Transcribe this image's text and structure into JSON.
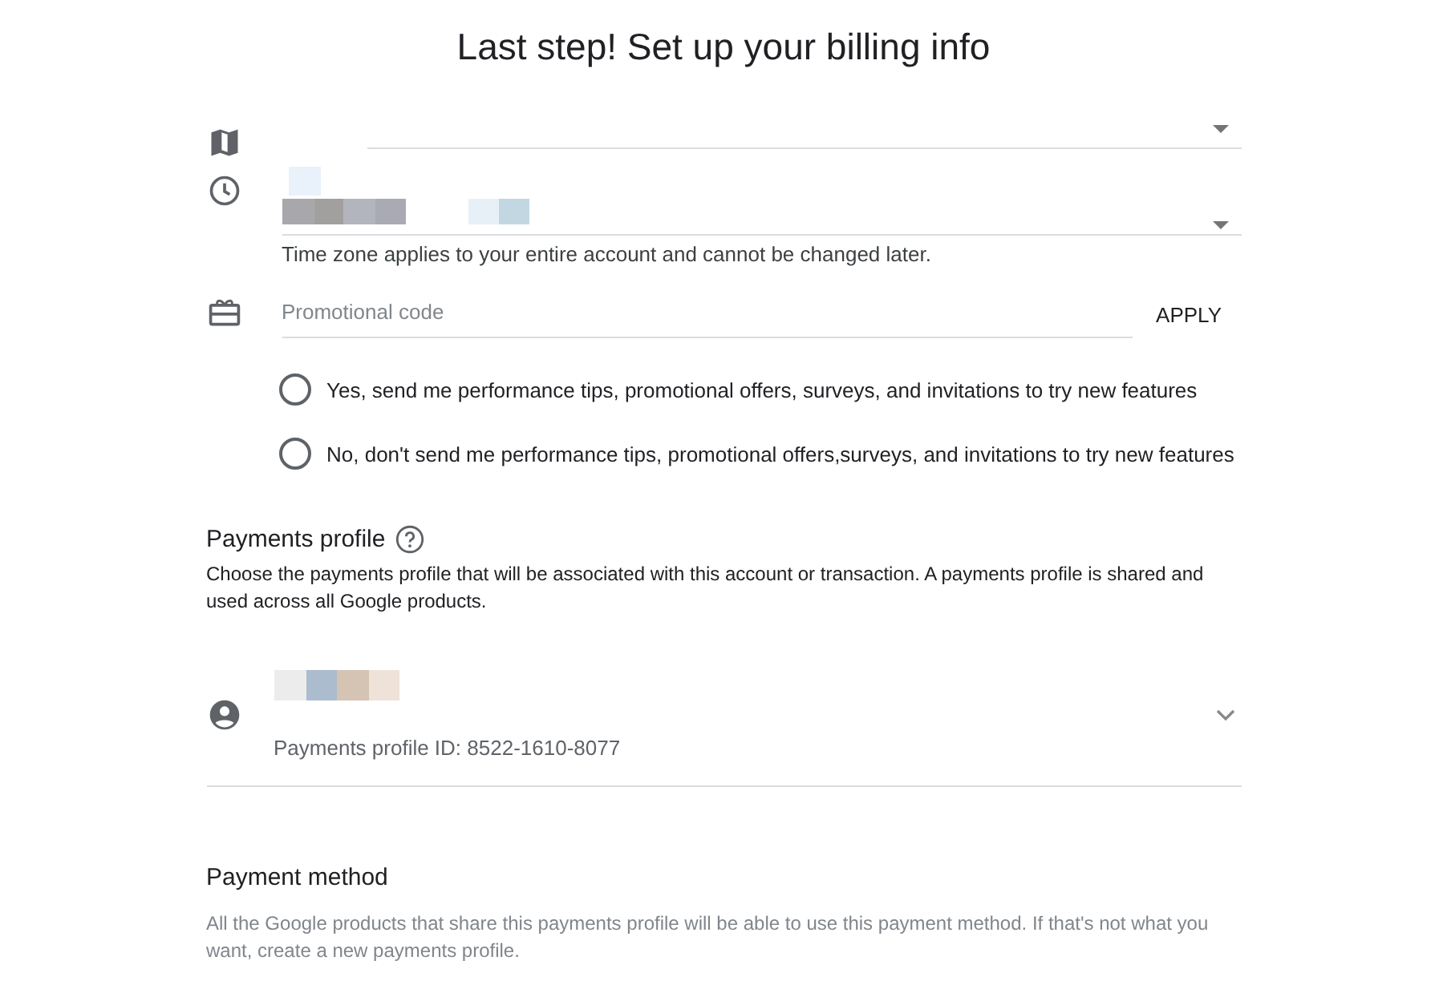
{
  "title": "Last step! Set up your billing info",
  "time_zone": {
    "helper": "Time zone applies to your entire account and cannot be changed later."
  },
  "promo": {
    "placeholder": "Promotional code",
    "apply": "APPLY"
  },
  "email_options": [
    {
      "label": "Yes, send me performance tips, promotional offers, surveys, and invitations to try new features",
      "selected": false
    },
    {
      "label": "No, don't send me performance tips, promotional offers,surveys, and invitations to try new features",
      "selected": false
    }
  ],
  "payments_profile": {
    "heading": "Payments profile",
    "description": "Choose the payments profile that will be associated with this account or transaction. A payments profile is shared and used across all Google products.",
    "profile_id": "Payments profile ID: 8522-1610-8077"
  },
  "payment_method": {
    "heading": "Payment method",
    "description": "All the Google products that share this payments profile will be able to use this payment method. If that's not what you want, create a new payments profile."
  }
}
